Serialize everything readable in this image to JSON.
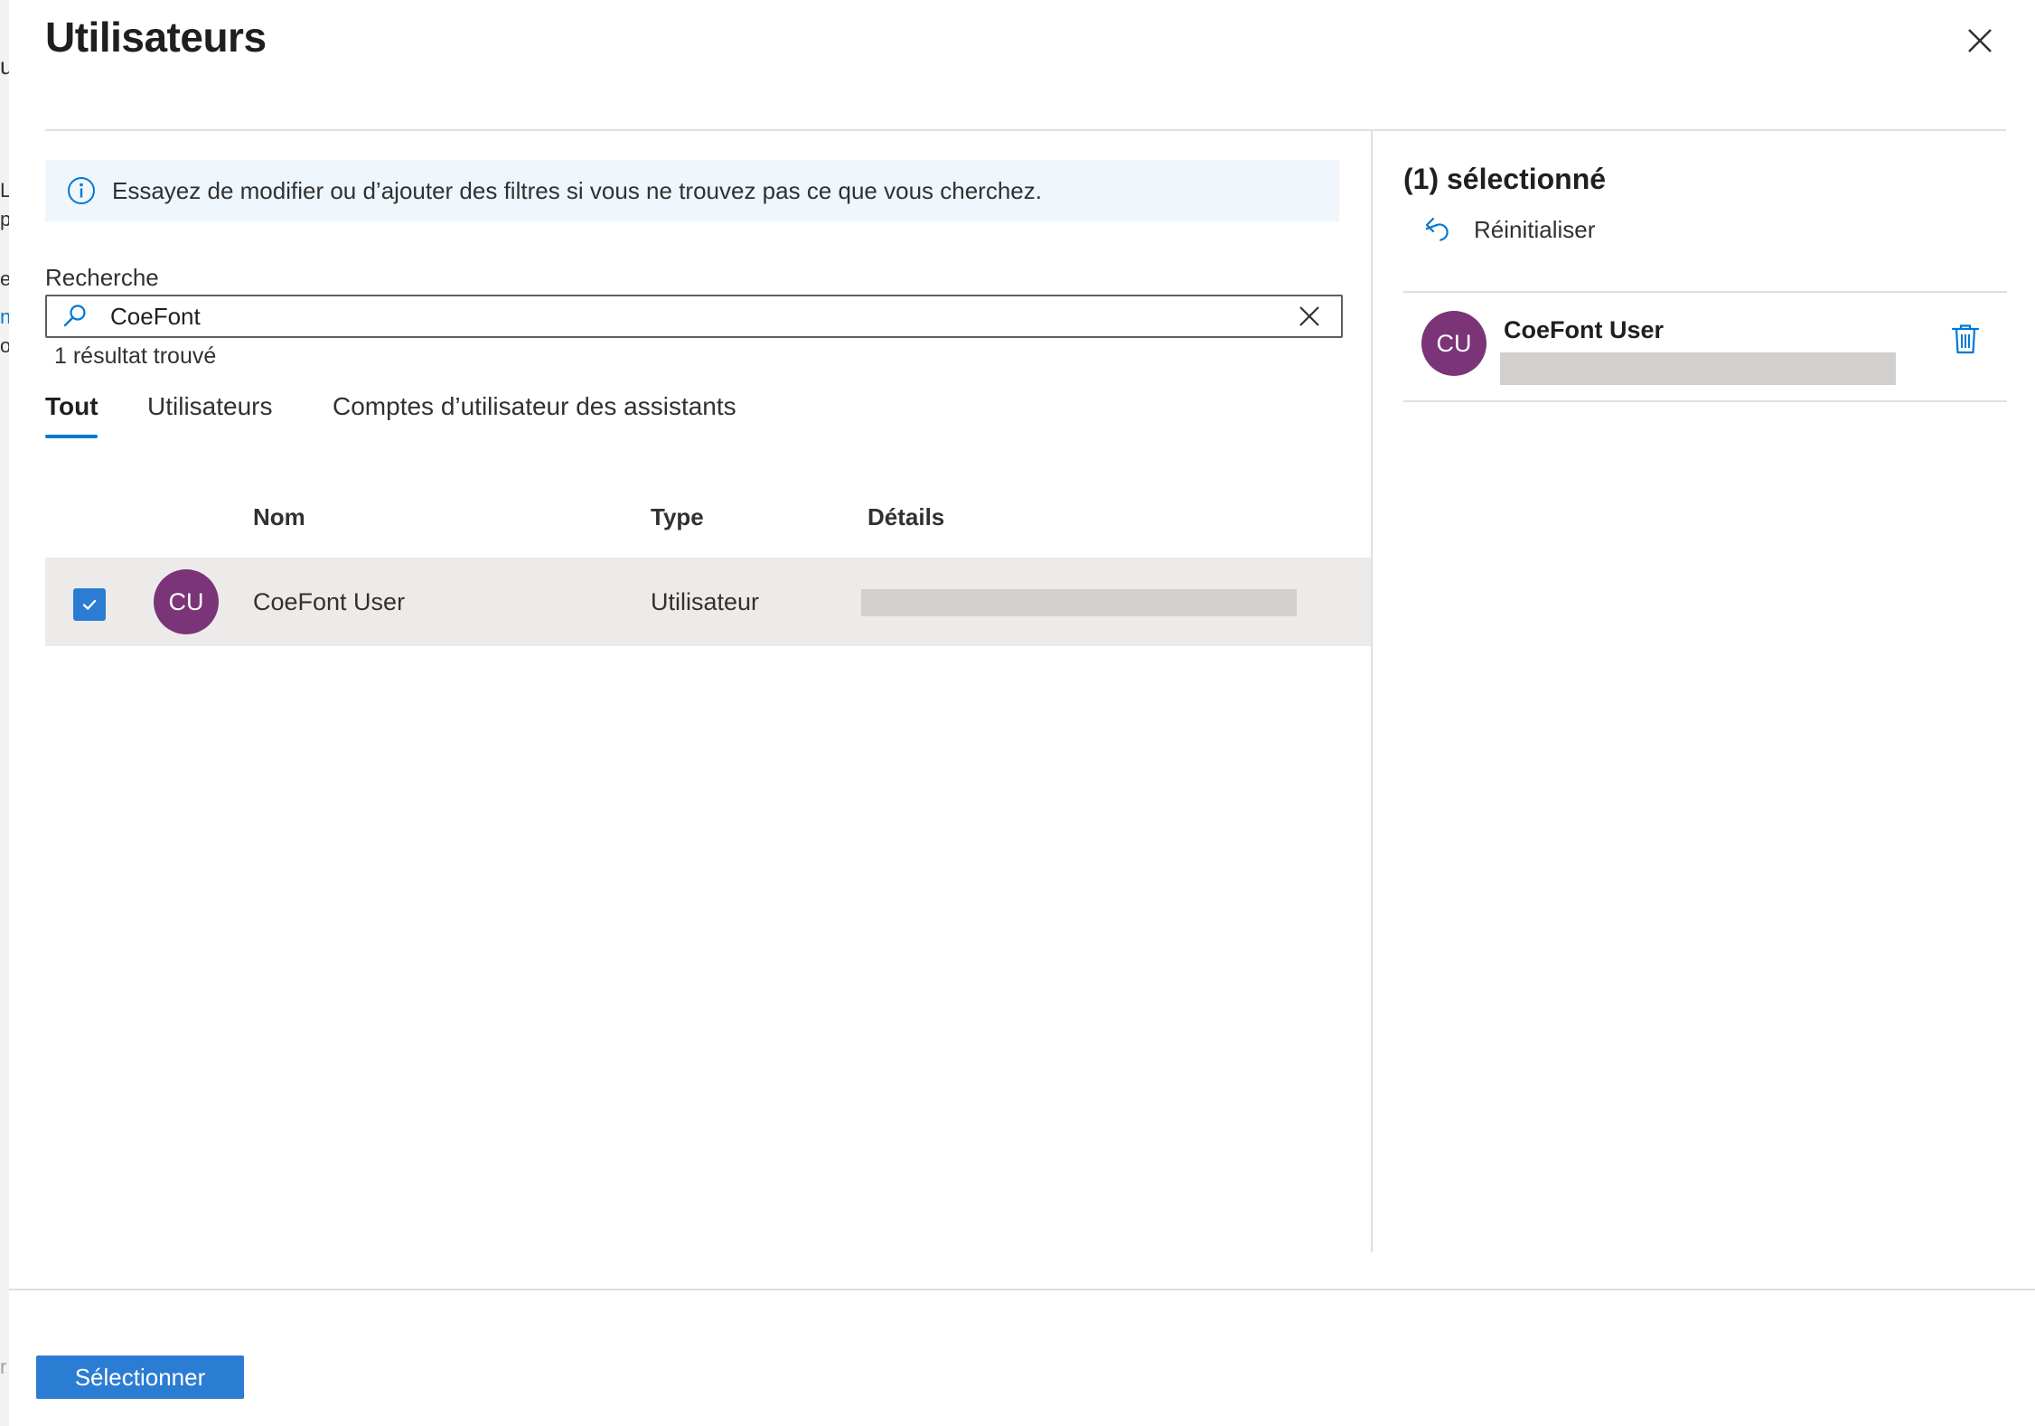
{
  "panel": {
    "title": "Utilisateurs"
  },
  "info": {
    "message": "Essayez de modifier ou d’ajouter des filtres si vous ne trouvez pas ce que vous cherchez."
  },
  "search": {
    "label": "Recherche",
    "value": "CoeFont",
    "result_count": "1 résultat trouvé"
  },
  "tabs": [
    {
      "label": "Tout",
      "active": true
    },
    {
      "label": "Utilisateurs",
      "active": false
    },
    {
      "label": "Comptes d’utilisateur des assistants",
      "active": false
    }
  ],
  "table": {
    "columns": [
      "Nom",
      "Type",
      "Détails"
    ],
    "rows": [
      {
        "initials": "CU",
        "name": "CoeFont User",
        "type": "Utilisateur",
        "checked": true
      }
    ]
  },
  "selection": {
    "title": "(1) sélectionné",
    "reset_label": "Réinitialiser",
    "items": [
      {
        "initials": "CU",
        "name": "CoeFont User"
      }
    ]
  },
  "footer": {
    "select_label": "Sélectionner"
  },
  "background_fragments": [
    "u",
    "L",
    "p",
    "e",
    "n",
    "o",
    "r"
  ],
  "colors": {
    "accent": "#2b7cd3",
    "avatar": "#7a3477",
    "info_bg": "#eff6fc",
    "row_selected_bg": "#edebe9"
  }
}
